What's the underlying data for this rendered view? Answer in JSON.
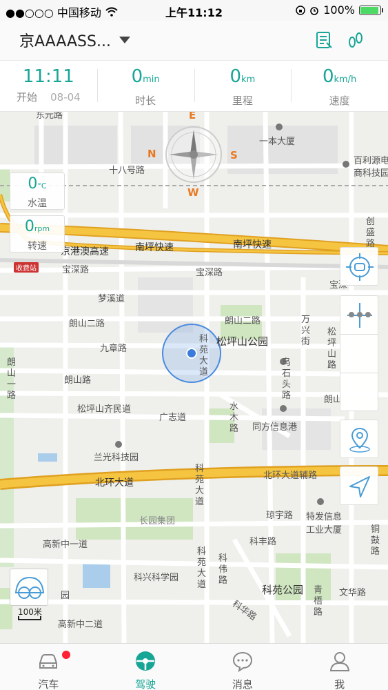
{
  "status_bar": {
    "carrier": "●●○○○ 中国移动",
    "time": "上午11:12",
    "battery_percent": "100%",
    "icons": [
      "wifi-icon",
      "lock-rotation-icon",
      "alarm-icon",
      "battery-icon"
    ]
  },
  "header": {
    "title": "京AAAASS...",
    "icons": [
      "report-icon",
      "footprint-icon"
    ]
  },
  "stats": [
    {
      "value": "11:11",
      "unit": "",
      "label": "开始",
      "extra": "08-04"
    },
    {
      "value": "0",
      "unit": "min",
      "label": "时长"
    },
    {
      "value": "0",
      "unit": "km",
      "label": "里程"
    },
    {
      "value": "0",
      "unit": "km/h",
      "label": "速度"
    }
  ],
  "compass": {
    "n": "N",
    "e": "E",
    "s": "S",
    "w": "W"
  },
  "gauges": {
    "water_temp": {
      "value": "0",
      "unit": "°C",
      "label": "水温"
    },
    "rpm": {
      "value": "0",
      "unit": "rpm",
      "label": "转速"
    }
  },
  "map": {
    "labels": {
      "dongyuan": "东元路",
      "yiben": "一本大厦",
      "bailiyuan": "百利源电",
      "shangke": "商科技园",
      "shibahao": "十八号路",
      "chuangsheng": "创盛路",
      "jinggangao": "京港澳高速",
      "nanping1": "南坪快速",
      "nanping2": "南坪快速",
      "shoufei": "收费站",
      "baoshen1": "宝深路",
      "baoshen2": "宝深路",
      "baoshen3": "宝深",
      "mengxi": "梦溪道",
      "langshan2a": "朗山二路",
      "langshan2b": "朗山二路",
      "wanxing": "万兴街",
      "jiuzhang": "九章路",
      "songpingshan_park": "松坪山公园",
      "songpingshan_road": "松坪山路",
      "kewan": "科苑大道",
      "langshan_v": "朗山一路",
      "langshan": "朗山路",
      "wushitou": "乌石头路",
      "spsqm": "松坪山齐民道",
      "guangzhi": "广志道",
      "shuimu": "水木路",
      "tongfang": "同方信息港",
      "langshan_r": "朗山",
      "lanphang": "兰光科技园",
      "beihuan": "北环大道",
      "beihuan_fu": "北环大道辅路",
      "kewan2": "科苑大道",
      "changyuan": "长园集团",
      "qiongyu": "琼宇路",
      "texin": "特发信息工业大厦",
      "tonggu": "铜鼓路",
      "gaoxin_zhong1": "高新中一道",
      "kefeng": "科丰路",
      "kewan3": "科苑大道",
      "kewei": "科伟路",
      "kexing": "科兴科学园",
      "keyuan_park": "科苑公园",
      "qingwu": "青梧路",
      "wenhua": "文华路",
      "yuan": "园",
      "kehua": "科华路",
      "gaoxin_zhong2": "高新中二道"
    },
    "scale": "100米"
  },
  "tabs": [
    {
      "label": "汽车",
      "icon": "car-icon",
      "badge": true
    },
    {
      "label": "驾驶",
      "icon": "steering-wheel-icon",
      "active": true
    },
    {
      "label": "消息",
      "icon": "message-icon"
    },
    {
      "label": "我",
      "icon": "person-icon"
    }
  ],
  "colors": {
    "accent": "#17a596",
    "highway": "#f5c542",
    "highway_border": "#e0a020"
  }
}
